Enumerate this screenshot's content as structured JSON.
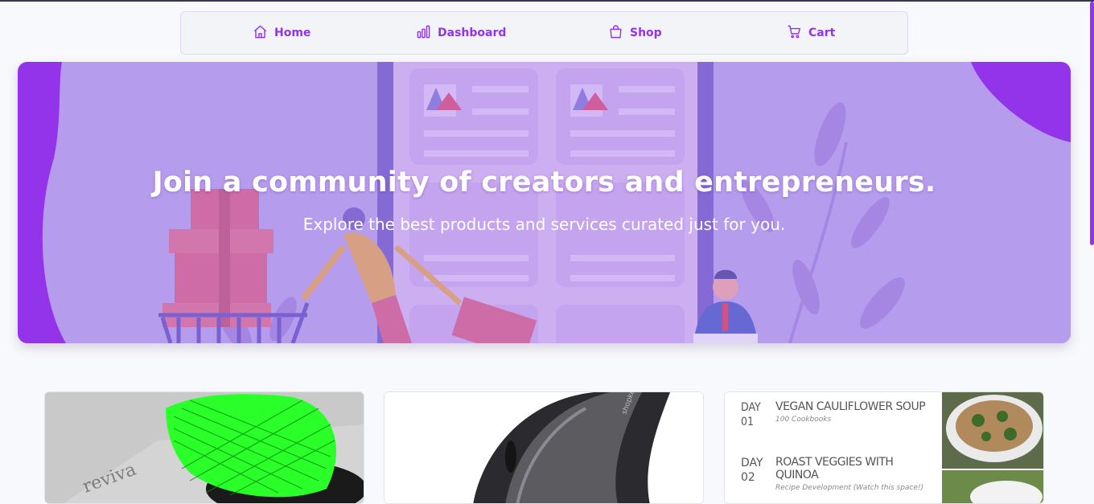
{
  "nav": {
    "items": [
      {
        "label": "Home",
        "icon": "home-icon"
      },
      {
        "label": "Dashboard",
        "icon": "bar-chart-icon"
      },
      {
        "label": "Shop",
        "icon": "shopping-bag-icon"
      },
      {
        "label": "Cart",
        "icon": "cart-icon"
      }
    ]
  },
  "hero": {
    "title": "Join a community of creators and entrepreneurs.",
    "subtitle": "Explore the best products and services curated just for you."
  },
  "products": [
    {
      "image": "green-led-mask-photo"
    },
    {
      "image": "black-vertical-mouse-photo",
      "brand_text": "shopkeeper"
    },
    {
      "image": "meal-plan-photo",
      "days": [
        {
          "day": "DAY",
          "num": "01",
          "title": "VEGAN CAULIFLOWER SOUP",
          "note": "100 Cookbooks"
        },
        {
          "day": "DAY",
          "num": "02",
          "title": "ROAST VEGGIES WITH QUINOA",
          "note": "Recipe Development (Watch this space!)"
        }
      ]
    }
  ],
  "colors": {
    "accent": "#9333ea",
    "hero_overlay": "#b79ef0",
    "page_bg": "#f8f9fc"
  }
}
